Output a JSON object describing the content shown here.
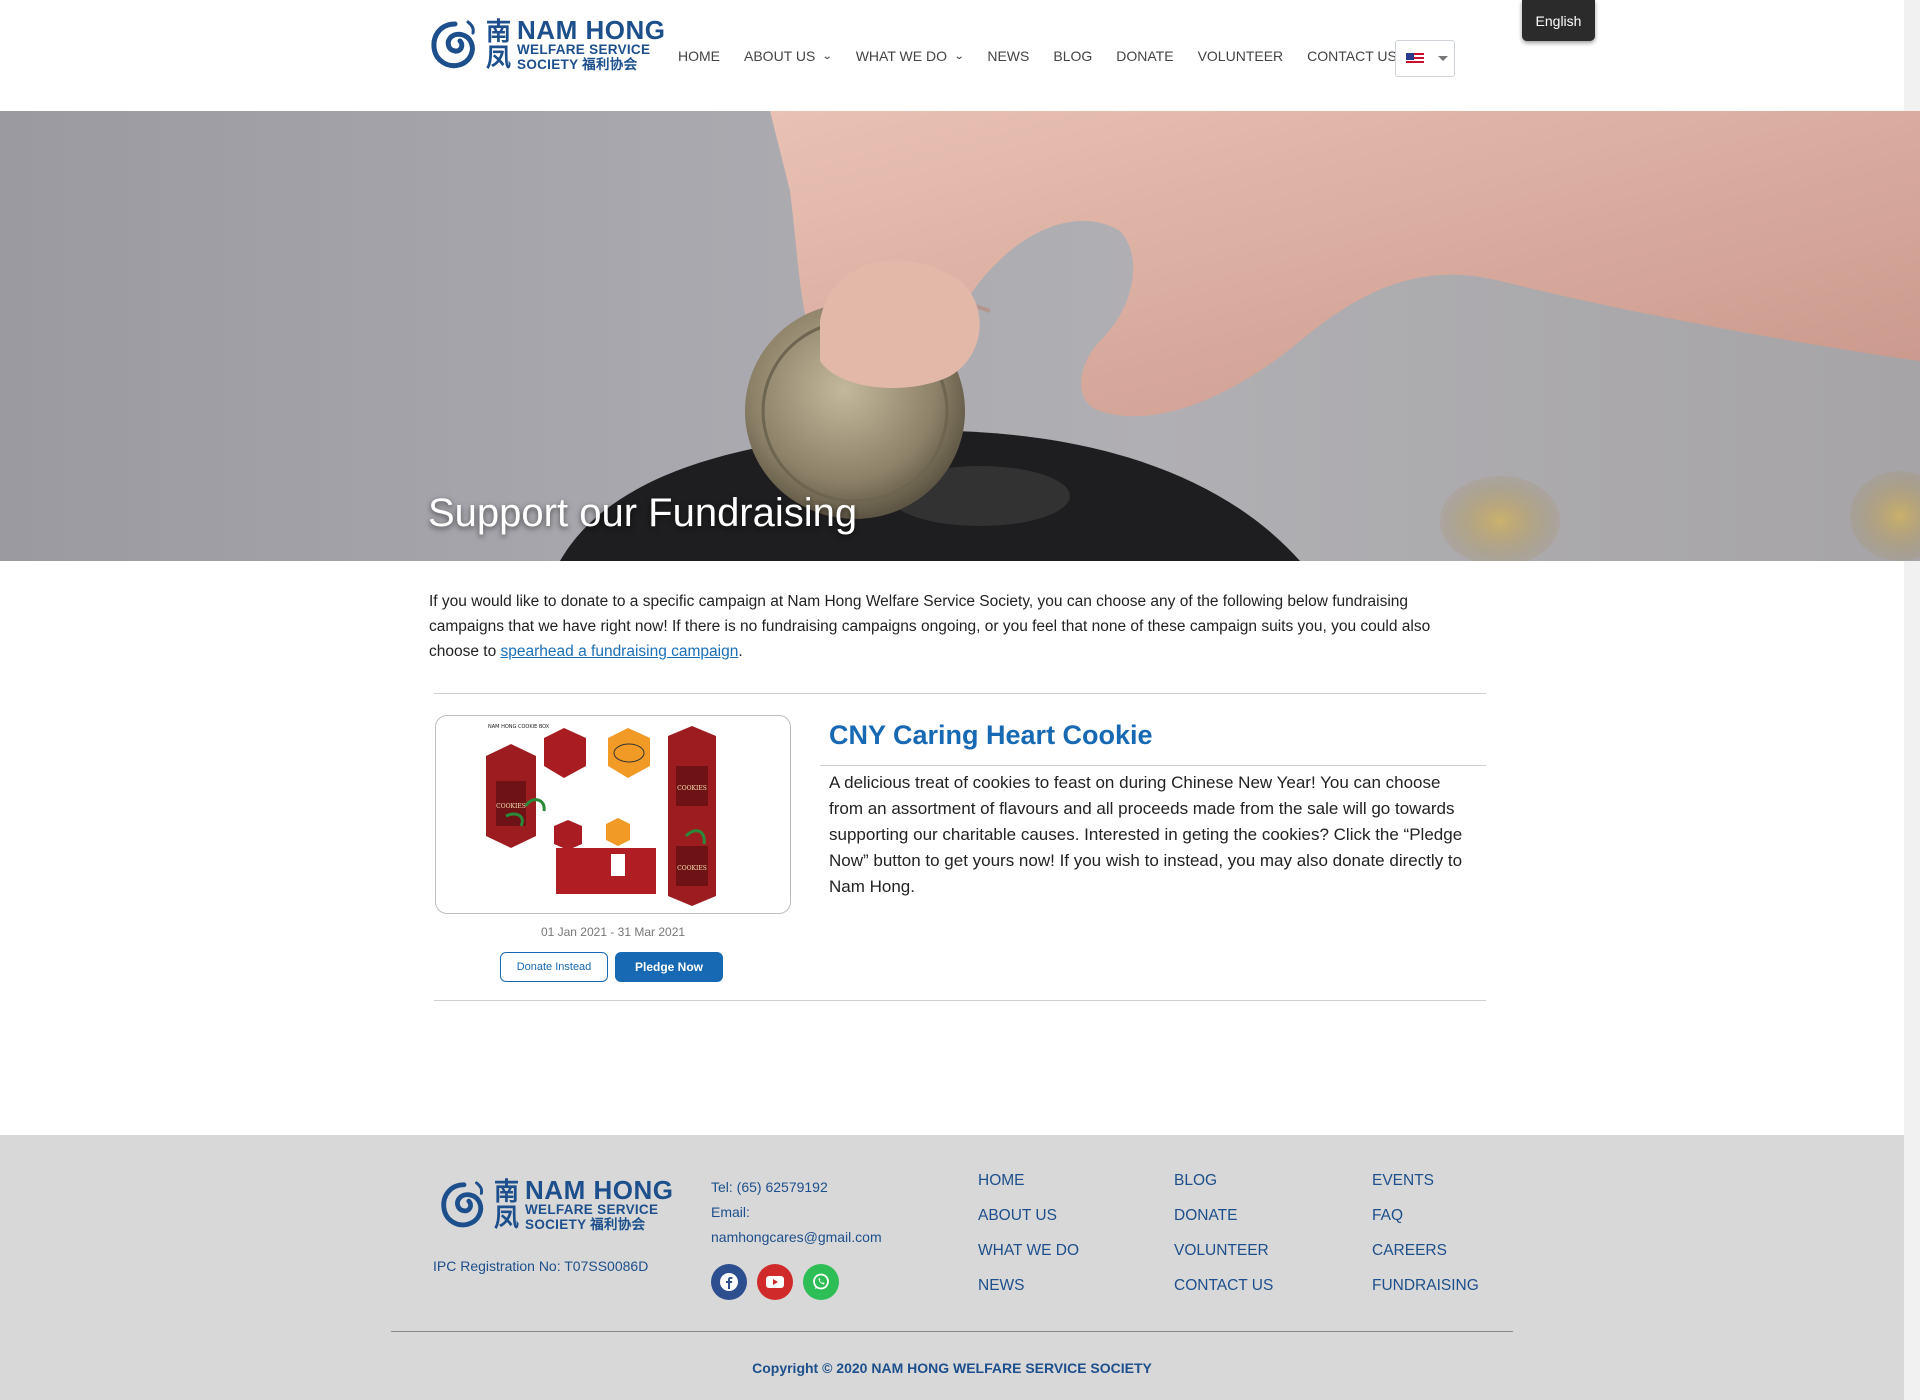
{
  "logo": {
    "cn_top": "南",
    "cn_bottom": "凤",
    "line1": "NAM HONG",
    "line2": "WELFARE SERVICE",
    "line3": "SOCIETY  福利协会"
  },
  "nav": {
    "items": [
      {
        "label": "HOME",
        "dropdown": false
      },
      {
        "label": "ABOUT US",
        "dropdown": true
      },
      {
        "label": "WHAT WE DO",
        "dropdown": true
      },
      {
        "label": "NEWS",
        "dropdown": false
      },
      {
        "label": "BLOG",
        "dropdown": false
      },
      {
        "label": "DONATE",
        "dropdown": false
      },
      {
        "label": "VOLUNTEER",
        "dropdown": false
      },
      {
        "label": "CONTACT US",
        "dropdown": false
      }
    ],
    "language_tooltip": "English"
  },
  "hero": {
    "title": "Support our Fundraising"
  },
  "intro": {
    "text_before": "If you would like to donate to a specific campaign at Nam Hong Welfare Service Society, you can choose any of the following below fundraising campaigns that we have right now! If there is no fundraising campaigns ongoing, or you feel that none of these campaign suits you, you could also choose to ",
    "link_text": "spearhead a fundraising campaign",
    "text_after": "."
  },
  "campaign": {
    "title": "CNY Caring Heart Cookie",
    "description": "A delicious treat of cookies to feast on during Chinese New Year! You can choose from an assortment of flavours and all proceeds made from the sale will go towards supporting our charitable causes. Interested in geting the cookies? Click the “Pledge Now” button to get yours now! If you wish to instead, you may also donate directly to Nam Hong.",
    "dates": "01 Jan 2021 - 31 Mar 2021",
    "donate_label": "Donate Instead",
    "pledge_label": "Pledge Now",
    "image_label_left": "NAM HONG COOKIE BOX",
    "image_box_text": "COOKIES"
  },
  "footer": {
    "ipc": "IPC Registration No: T07SS0086D",
    "tel": "Tel: (65) 62579192",
    "email_label": "Email:",
    "email": "namhongcares@gmail.com",
    "col1": [
      "HOME",
      "ABOUT US",
      "WHAT WE DO",
      "NEWS"
    ],
    "col2": [
      "BLOG",
      "DONATE",
      "VOLUNTEER",
      "CONTACT US"
    ],
    "col3": [
      "EVENTS",
      "FAQ",
      "CAREERS",
      "FUNDRAISING"
    ],
    "copyright": "Copyright © 2020 NAM HONG WELFARE SERVICE SOCIETY",
    "social_colors": {
      "facebook": "#2d4f8f",
      "youtube": "#d02a2a",
      "whatsapp": "#2dbe55"
    }
  },
  "colors": {
    "accent": "#1769b3",
    "brand": "#1c4f8c",
    "footer_bg": "#d8d8d8"
  }
}
